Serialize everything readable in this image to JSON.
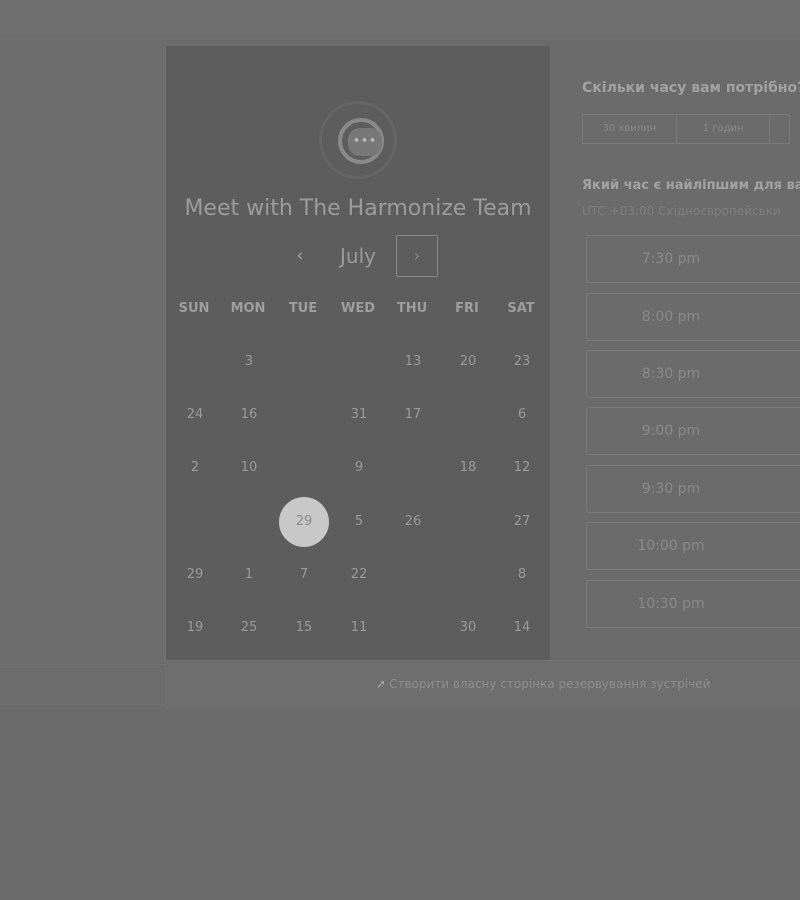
{
  "calendar": {
    "title": "Meet with The Harmonize Team",
    "month": "July",
    "prev_icon": "‹",
    "next_icon": "›",
    "logo_dots": "•••",
    "weekdays": [
      "SUN",
      "MON",
      "TUE",
      "WED",
      "THU",
      "FRI",
      "SAT"
    ],
    "rows": [
      [
        "",
        "3",
        "",
        "",
        "13",
        "20",
        "23"
      ],
      [
        "24",
        "16",
        "",
        "31",
        "17",
        "",
        "6"
      ],
      [
        "2",
        "10",
        "",
        "9",
        "",
        "18",
        "12"
      ],
      [
        "",
        "",
        "29",
        "5",
        "26",
        "",
        "27"
      ],
      [
        "29",
        "1",
        "7",
        "22",
        "",
        "",
        "8"
      ],
      [
        "19",
        "25",
        "15",
        "11",
        "",
        "30",
        "14"
      ]
    ],
    "selected_day": "29"
  },
  "duration": {
    "question": "Скільки часу вам потрібно?",
    "options": [
      "30 хвилин",
      "1 годин",
      ""
    ]
  },
  "time": {
    "question": "Який час є найліпшим для ва",
    "timezone": "UTC +03:00 Східноєвропейськи",
    "slots": [
      "7:30 pm",
      "8:00 pm",
      "8:30 pm",
      "9:00 pm",
      "9:30 pm",
      "10:00 pm",
      "10:30 pm"
    ]
  },
  "footer": {
    "icon": "➚",
    "link": "Створити власну сторінка резервування зустрічей"
  }
}
